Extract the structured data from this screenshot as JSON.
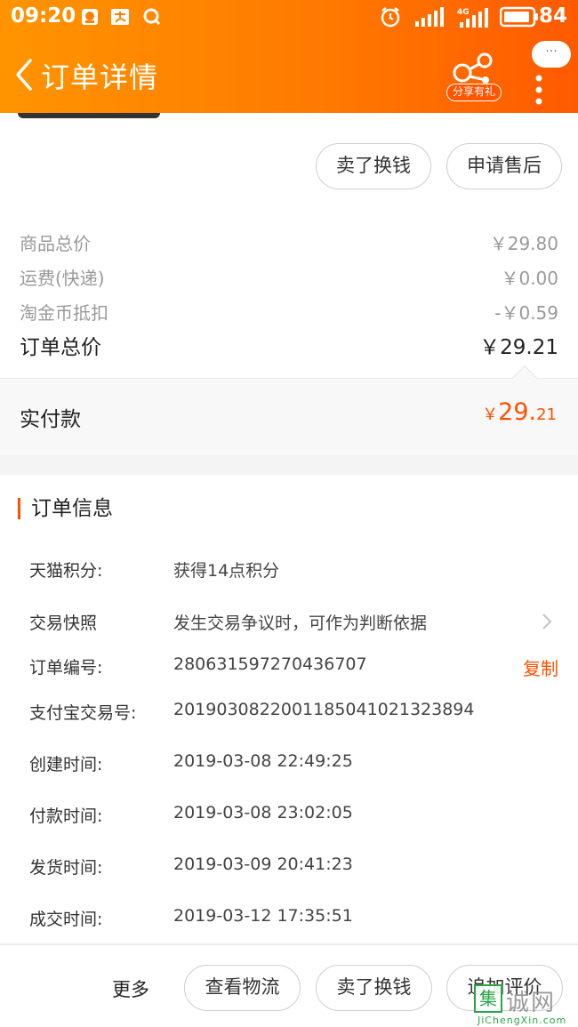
{
  "status_bar": {
    "time": "09:20",
    "battery": "84",
    "network": "4G"
  },
  "header": {
    "title": "订单详情",
    "share_badge": "分享有礼",
    "chat_bubble": "···"
  },
  "actions_top": {
    "sell_for_cash": "卖了换钱",
    "after_sale": "申请售后"
  },
  "prices": {
    "items": [
      {
        "label": "商品总价",
        "value": "￥29.80"
      },
      {
        "label": "运费(快递)",
        "value": "￥0.00"
      },
      {
        "label": "淘金币抵扣",
        "value": "-￥0.59"
      }
    ],
    "total_label": "订单总价",
    "total_value": "￥29.21",
    "paid_label": "实付款",
    "paid_currency": "￥",
    "paid_integer": "29.",
    "paid_decimal": "21"
  },
  "order_info": {
    "section_title": "订单信息",
    "rows": [
      {
        "key": "天猫积分:",
        "value": "获得14点积分"
      },
      {
        "key": "交易快照",
        "value": "发生交易争议时，可作为判断依据"
      },
      {
        "key": "订单编号:",
        "value": "280631597270436707",
        "action": "复制"
      },
      {
        "key": "支付宝交易号:",
        "value": "2019030822001185041021323894"
      },
      {
        "key": "创建时间:",
        "value": "2019-03-08 22:49:25"
      },
      {
        "key": "付款时间:",
        "value": "2019-03-08 23:02:05"
      },
      {
        "key": "发货时间:",
        "value": "2019-03-09 20:41:23"
      },
      {
        "key": "成交时间:",
        "value": "2019-03-12 17:35:51"
      }
    ]
  },
  "bottom_bar": {
    "more": "更多",
    "view_logistics": "查看物流",
    "sell_for_cash": "卖了换钱",
    "add_review": "追加评价"
  },
  "watermark": {
    "box_char": "集",
    "text": "诚网",
    "url": "JiChengXin.com"
  },
  "colors": {
    "accent": "#ff5000",
    "header_start": "#ff9400",
    "header_end": "#ff5a00"
  }
}
